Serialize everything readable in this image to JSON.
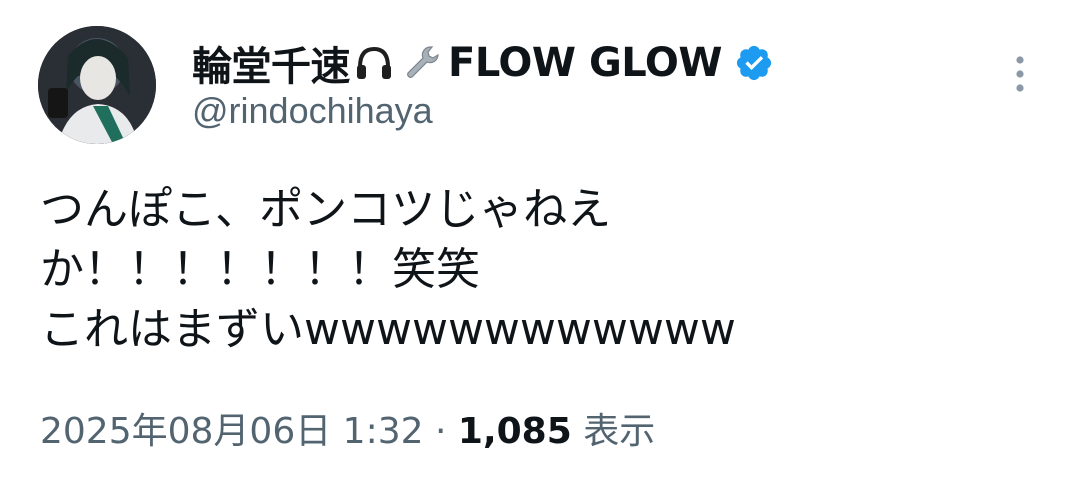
{
  "author": {
    "display_name": "輪堂千速",
    "display_name_suffix": "FLOW GLOW",
    "handle": "@rindochihaya",
    "verified_color": "#1d9bf0",
    "emoji_icons": [
      "headphones-icon",
      "wrench-icon"
    ]
  },
  "tweet": {
    "lines": [
      "つんぽこ、ポンコツじゃねえ",
      "か！！！！！！！笑笑",
      "これはまずいwwwwwwwwwwww"
    ]
  },
  "meta": {
    "timestamp": "2025年08月06日 1:32",
    "separator": "·",
    "view_count": "1,085",
    "views_label": "表示"
  },
  "colors": {
    "text": "#0f1419",
    "secondary": "#536471"
  },
  "icons": {
    "more": "more-vertical-icon",
    "verified": "verified-badge-icon"
  }
}
